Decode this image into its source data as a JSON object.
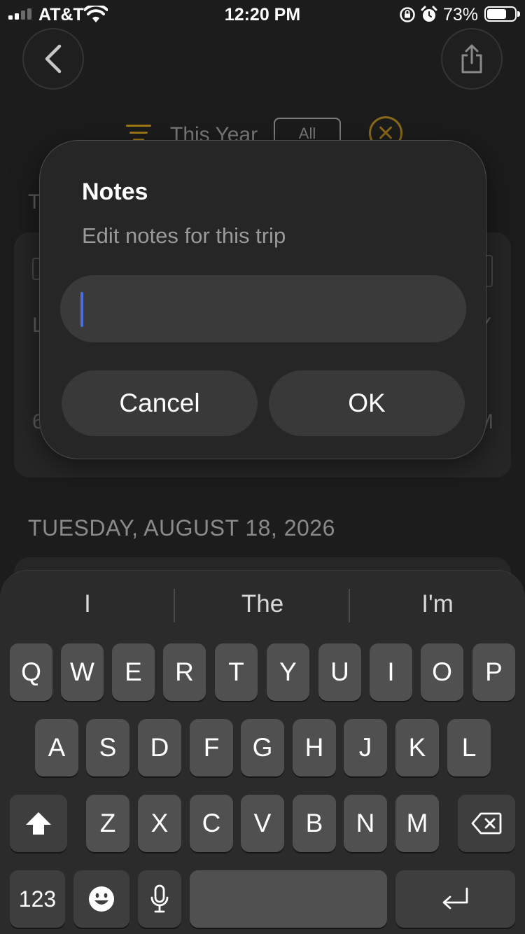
{
  "status_bar": {
    "carrier": "AT&T",
    "time": "12:20 PM",
    "battery_percent": "73%",
    "battery_level": 0.73,
    "icons": [
      "signal-icon",
      "wifi-icon",
      "orientation-lock-icon",
      "alarm-icon",
      "battery-icon"
    ]
  },
  "background": {
    "filter_label": "This Year",
    "filter_pill": "All",
    "section_letter": "T",
    "card_left_1": "L",
    "card_right_1": "Y",
    "card_left_2": "6",
    "card_right_2": "M",
    "date_header": "TUESDAY, AUGUST 18, 2026",
    "accent_color": "#a07a18"
  },
  "dialog": {
    "title": "Notes",
    "message": "Edit notes for this trip",
    "input_value": "",
    "cancel_label": "Cancel",
    "ok_label": "OK",
    "caret_color": "#4a6fe0"
  },
  "keyboard": {
    "suggestions": [
      "I",
      "The",
      "I'm"
    ],
    "row1": [
      "Q",
      "W",
      "E",
      "R",
      "T",
      "Y",
      "U",
      "I",
      "O",
      "P"
    ],
    "row2": [
      "A",
      "S",
      "D",
      "F",
      "G",
      "H",
      "J",
      "K",
      "L"
    ],
    "row3": [
      "Z",
      "X",
      "C",
      "V",
      "B",
      "N",
      "M"
    ],
    "numbers_label": "123",
    "special_icons": [
      "shift-icon",
      "backspace-icon",
      "emoji-icon",
      "microphone-icon",
      "return-icon"
    ]
  }
}
